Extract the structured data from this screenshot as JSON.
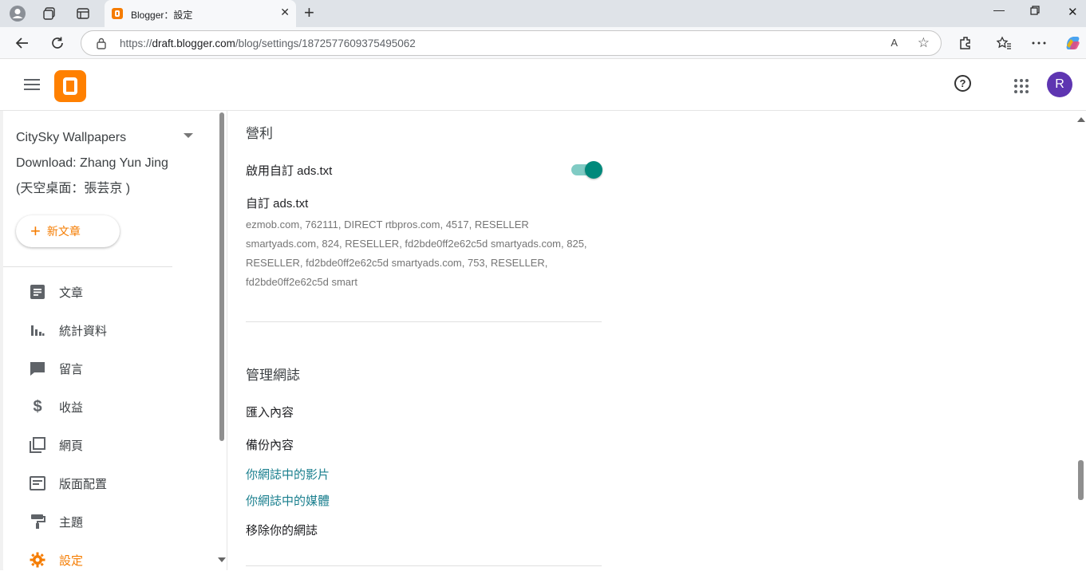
{
  "browser": {
    "tab_title": "Blogger：設定",
    "url_scheme": "https://",
    "url_host": "draft.blogger.com",
    "url_path": "/blog/settings/1872577609375495062",
    "read_aloud": "A",
    "close_glyph": "✕",
    "newtab_glyph": "+"
  },
  "header": {
    "avatar_letter": "R",
    "help_glyph": "?"
  },
  "sidebar": {
    "blog_name": "CitySky Wallpapers Download: Zhang Yun Jing (天空桌面：張芸京 )",
    "new_post_label": "新文章",
    "items": [
      {
        "label": "文章",
        "icon": "posts-icon"
      },
      {
        "label": "統計資料",
        "icon": "stats-icon"
      },
      {
        "label": "留言",
        "icon": "comments-icon"
      },
      {
        "label": "收益",
        "icon": "earnings-icon"
      },
      {
        "label": "網頁",
        "icon": "pages-icon"
      },
      {
        "label": "版面配置",
        "icon": "layout-icon"
      },
      {
        "label": "主題",
        "icon": "theme-icon"
      },
      {
        "label": "設定",
        "icon": "settings-icon"
      }
    ]
  },
  "main": {
    "monetization_title": "營利",
    "enable_custom_ads_label": "啟用自訂 ads.txt",
    "enable_custom_ads_on": true,
    "custom_ads_title": "自訂 ads.txt",
    "custom_ads_content": "ezmob.com, 762111, DIRECT rtbpros.com, 4517, RESELLER smartyads.com, 824, RESELLER, fd2bde0ff2e62c5d smartyads.com, 825, RESELLER, fd2bde0ff2e62c5d smartyads.com, 753, RESELLER, fd2bde0ff2e62c5d smart",
    "manage_title": "管理網誌",
    "import_label": "匯入內容",
    "backup_label": "備份內容",
    "videos_link": "你網誌中的影片",
    "media_link": "你網誌中的媒體",
    "remove_label": "移除你的網誌"
  },
  "colors": {
    "accent": "#f57c00",
    "toggle": "#00897b",
    "link": "#1a7f8e",
    "avatar": "#5e35b1"
  }
}
